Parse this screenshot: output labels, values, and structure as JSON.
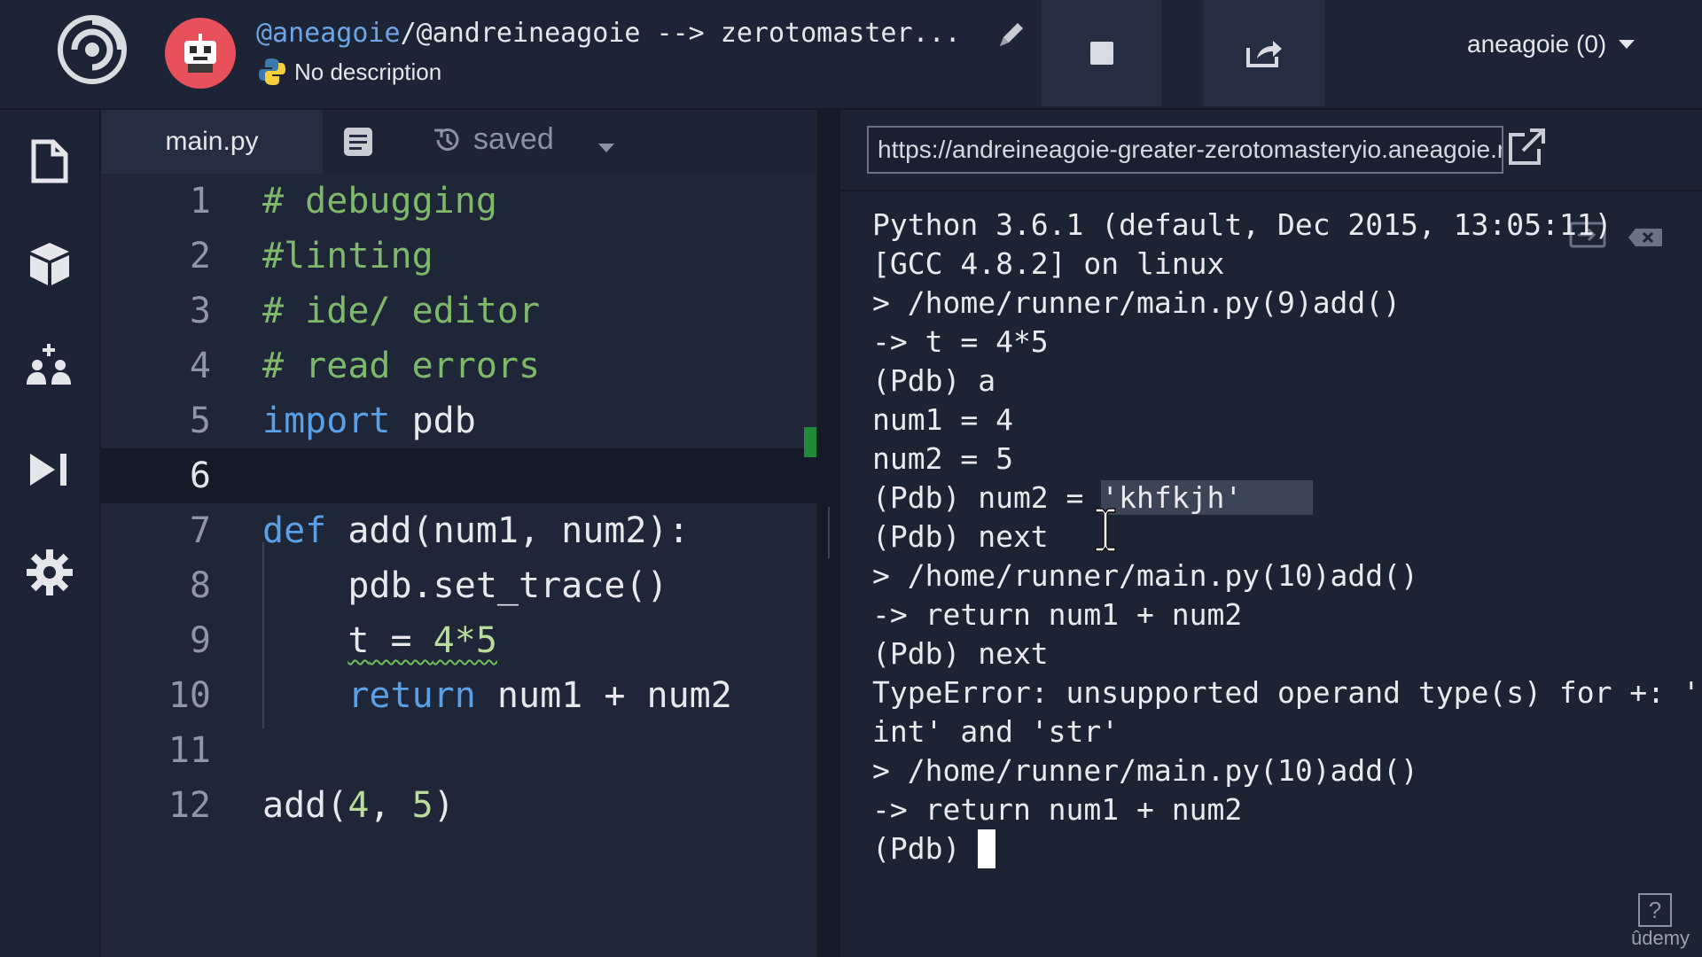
{
  "header": {
    "repl_user": "@aneagoie",
    "repl_path": "/@andreineagoie --> zerotomaster...",
    "description": "No description",
    "account_label": "aneagoie (0)"
  },
  "editor": {
    "tab_file": "main.py",
    "status": "saved",
    "lines": [
      {
        "n": "1"
      },
      {
        "n": "2"
      },
      {
        "n": "3"
      },
      {
        "n": "4"
      },
      {
        "n": "5"
      },
      {
        "n": "6"
      },
      {
        "n": "7"
      },
      {
        "n": "8"
      },
      {
        "n": "9"
      },
      {
        "n": "10"
      },
      {
        "n": "11"
      },
      {
        "n": "12"
      }
    ],
    "code": {
      "l1": "# debugging",
      "l2": "#linting",
      "l3": "# ide/ editor",
      "l4": "# read errors",
      "l5_kw": "import",
      "l5_rest": " pdb",
      "l7_kw": "def",
      "l7_rest": " add(num1, num2):",
      "l8": "    pdb.set_trace()",
      "l9_indent": "    ",
      "l9_a": "t",
      "l9_b": " = ",
      "l9_c": "4*5",
      "l10_indent": "    ",
      "l10_kw": "return",
      "l10_rest": " num1 + num2",
      "l12_a": "add(",
      "l12_b": "4",
      "l12_c": ", ",
      "l12_d": "5",
      "l12_e": ")"
    }
  },
  "console": {
    "url": "https://andreineagoie-greater-zerotomasteryio.aneagoie.repl.run",
    "out1": "Python 3.6.1 (default, Dec 2015, 13:05:11)",
    "out2": "[GCC 4.8.2] on linux",
    "out3": "> /home/runner/main.py(9)add()",
    "out4": "-> t = 4*5",
    "out5": "(Pdb) a",
    "out6": "num1 = 4",
    "out7": "num2 = 5",
    "out8a": "(Pdb) num2 = ",
    "out8b": "'khfkjh'",
    "out9": "(Pdb) next",
    "out10": "> /home/runner/main.py(10)add()",
    "out11": "-> return num1 + num2",
    "out12": "(Pdb) next",
    "out13": "TypeError: unsupported operand type(s) for +: '",
    "out14": "int' and 'str'",
    "out15": "> /home/runner/main.py(10)add()",
    "out16": "-> return num1 + num2",
    "out17": "(Pdb) "
  },
  "footer": {
    "help": "?",
    "brand": "ûdemy"
  }
}
